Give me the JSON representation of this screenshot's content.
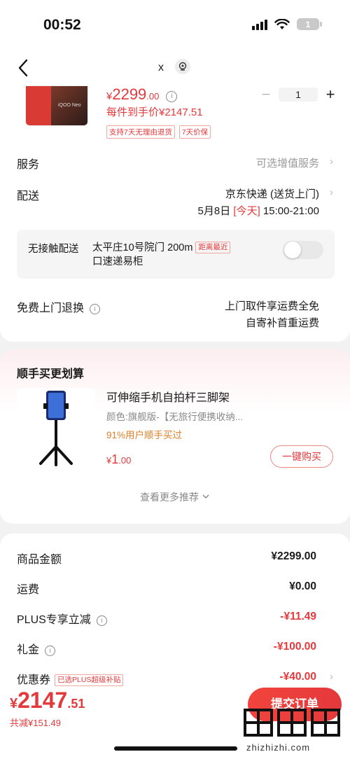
{
  "status_bar": {
    "time": "00:52",
    "battery": "1"
  },
  "nav": {
    "close_label": "x"
  },
  "product": {
    "image_brand": "iQOO Neo",
    "price_symbol": "¥",
    "price_integer": "2299",
    "price_decimal": ".00",
    "per_piece_price": "每件到手价¥2147.51",
    "quantity": "1",
    "tags": [
      "支持7天无理由退货",
      "7天价保"
    ]
  },
  "service": {
    "label": "服务",
    "value": "可选增值服务"
  },
  "delivery": {
    "label": "配送",
    "method": "京东快递 (送货上门)",
    "date_prefix": "5月8日",
    "date_today": "[今天]",
    "time_window": "15:00-21:00"
  },
  "contactless": {
    "label": "无接触配送",
    "address": "太平庄10号院门 200m",
    "badge": "距离最近",
    "address_line2": "口速递易柜",
    "enabled": false
  },
  "free_return": {
    "label": "免费上门退换",
    "line1": "上门取件享运费全免",
    "line2": "自寄补首重运费"
  },
  "recommend": {
    "title": "顺手买更划算",
    "item_name": "可伸缩手机自拍杆三脚架",
    "item_color": "颜色:旗舰版-【无旅行便携收纳...",
    "item_stat": "91%用户顺手买过",
    "price_symbol": "¥",
    "price_integer": "1",
    "price_decimal": ".00",
    "buy_label": "一键购买",
    "more_label": "查看更多推荐"
  },
  "fees": {
    "goods_label": "商品金额",
    "goods_value": "¥2299.00",
    "shipping_label": "运费",
    "shipping_value": "¥0.00",
    "plus_label": "PLUS专享立减",
    "plus_value": "-¥11.49",
    "gift_label": "礼金",
    "gift_value": "-¥100.00",
    "coupon_label": "优惠券",
    "coupon_tag": "已选PLUS超级补贴",
    "coupon_value": "-¥40.00"
  },
  "bottom": {
    "total_symbol": "¥",
    "total_integer": "2147",
    "total_decimal": ".51",
    "saved": "共减¥151.49",
    "submit_label": "提交订单"
  },
  "watermark": {
    "url": "zhizhizhi.com"
  },
  "colors": {
    "accent": "#e4393c",
    "background": "#f2f2f2",
    "badge_orange": "#e0802a"
  }
}
